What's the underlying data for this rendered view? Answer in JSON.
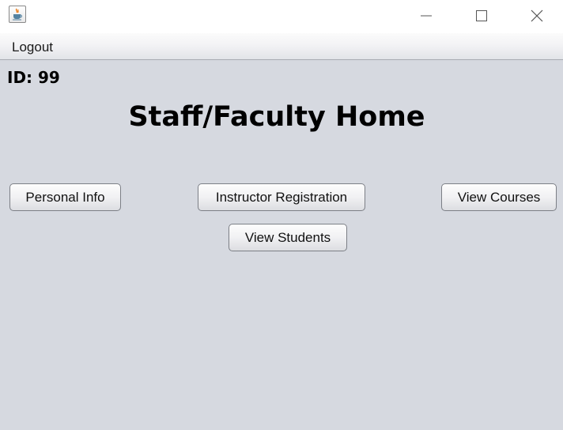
{
  "window": {
    "title": "",
    "minimize_icon": "minimize-icon",
    "maximize_icon": "maximize-icon",
    "close_icon": "close-icon"
  },
  "menubar": {
    "logout_label": "Logout"
  },
  "content": {
    "id_label": "ID: 99",
    "title": "Staff/Faculty Home"
  },
  "buttons": {
    "personal_info": "Personal Info",
    "instructor_registration": "Instructor Registration",
    "view_courses": "View Courses",
    "view_students": "View Students"
  }
}
